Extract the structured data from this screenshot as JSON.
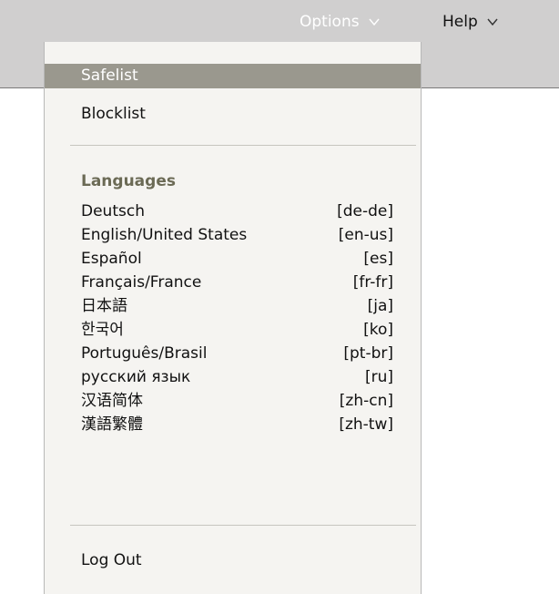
{
  "header": {
    "options_label": "Options",
    "help_label": "Help"
  },
  "menu": {
    "items_top": [
      {
        "label": "Safelist",
        "selected": true
      },
      {
        "label": "Blocklist",
        "selected": false
      }
    ],
    "languages_heading": "Languages",
    "languages": [
      {
        "name": "Deutsch",
        "code": "[de-de]"
      },
      {
        "name": "English/United States",
        "code": "[en-us]"
      },
      {
        "name": "Español",
        "code": "[es]"
      },
      {
        "name": "Français/France",
        "code": "[fr-fr]"
      },
      {
        "name": "日本語",
        "code": "[ja]"
      },
      {
        "name": "한국어",
        "code": "[ko]"
      },
      {
        "name": "Português/Brasil",
        "code": "[pt-br]"
      },
      {
        "name": "русский язык",
        "code": "[ru]"
      },
      {
        "name": "汉语简体",
        "code": "[zh-cn]"
      },
      {
        "name": "漢語繁體",
        "code": "[zh-tw]"
      }
    ],
    "logout_label": "Log Out"
  }
}
